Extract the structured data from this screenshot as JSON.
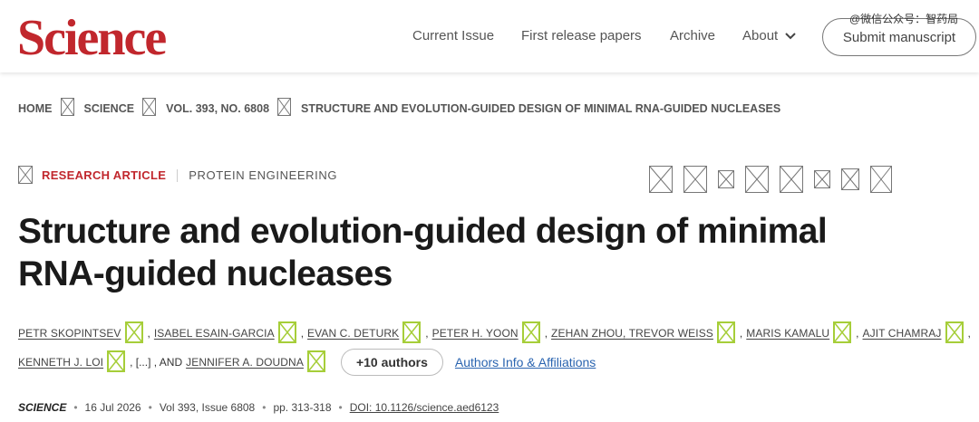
{
  "header": {
    "logo": "Science",
    "nav": [
      "Current Issue",
      "First release papers",
      "Archive"
    ],
    "about_label": "About",
    "submit_label": "Submit manuscript",
    "watermark": "@微信公众号：智药局"
  },
  "breadcrumb": [
    "HOME",
    "SCIENCE",
    "VOL. 393, NO. 6808",
    "STRUCTURE AND EVOLUTION-GUIDED DESIGN OF MINIMAL RNA-GUIDED NUCLEASES"
  ],
  "article": {
    "type": "RESEARCH ARTICLE",
    "subject": "PROTEIN ENGINEERING",
    "title": "Structure and evolution-guided design of minimal RNA-guided nucleases"
  },
  "authors": {
    "row1": [
      "PETR SKOPINTSEV",
      "ISABEL ESAIN-GARCIA",
      "EVAN C. DETURK",
      "PETER H. YOON",
      "ZEHAN ZHOU, TREVOR WEISS",
      "MARIS KAMALU",
      "AJIT CHAMRAJ"
    ],
    "row2_first": "KENNETH J. LOI",
    "ellipsis": ", [...] , AND",
    "last": "JENNIFER A. DOUDNA",
    "more_label": "+10 authors",
    "affiliations_label": "Authors Info & Affiliations"
  },
  "citation": {
    "journal": "SCIENCE",
    "date": "16 Jul 2026",
    "volume": "Vol 393, Issue 6808",
    "pages": "pp. 313-318",
    "doi": "DOI: 10.1126/science.aed6123"
  },
  "colors": {
    "brand": "#c1272d",
    "link": "#2a64b0",
    "orcid": "#a6ce39"
  }
}
